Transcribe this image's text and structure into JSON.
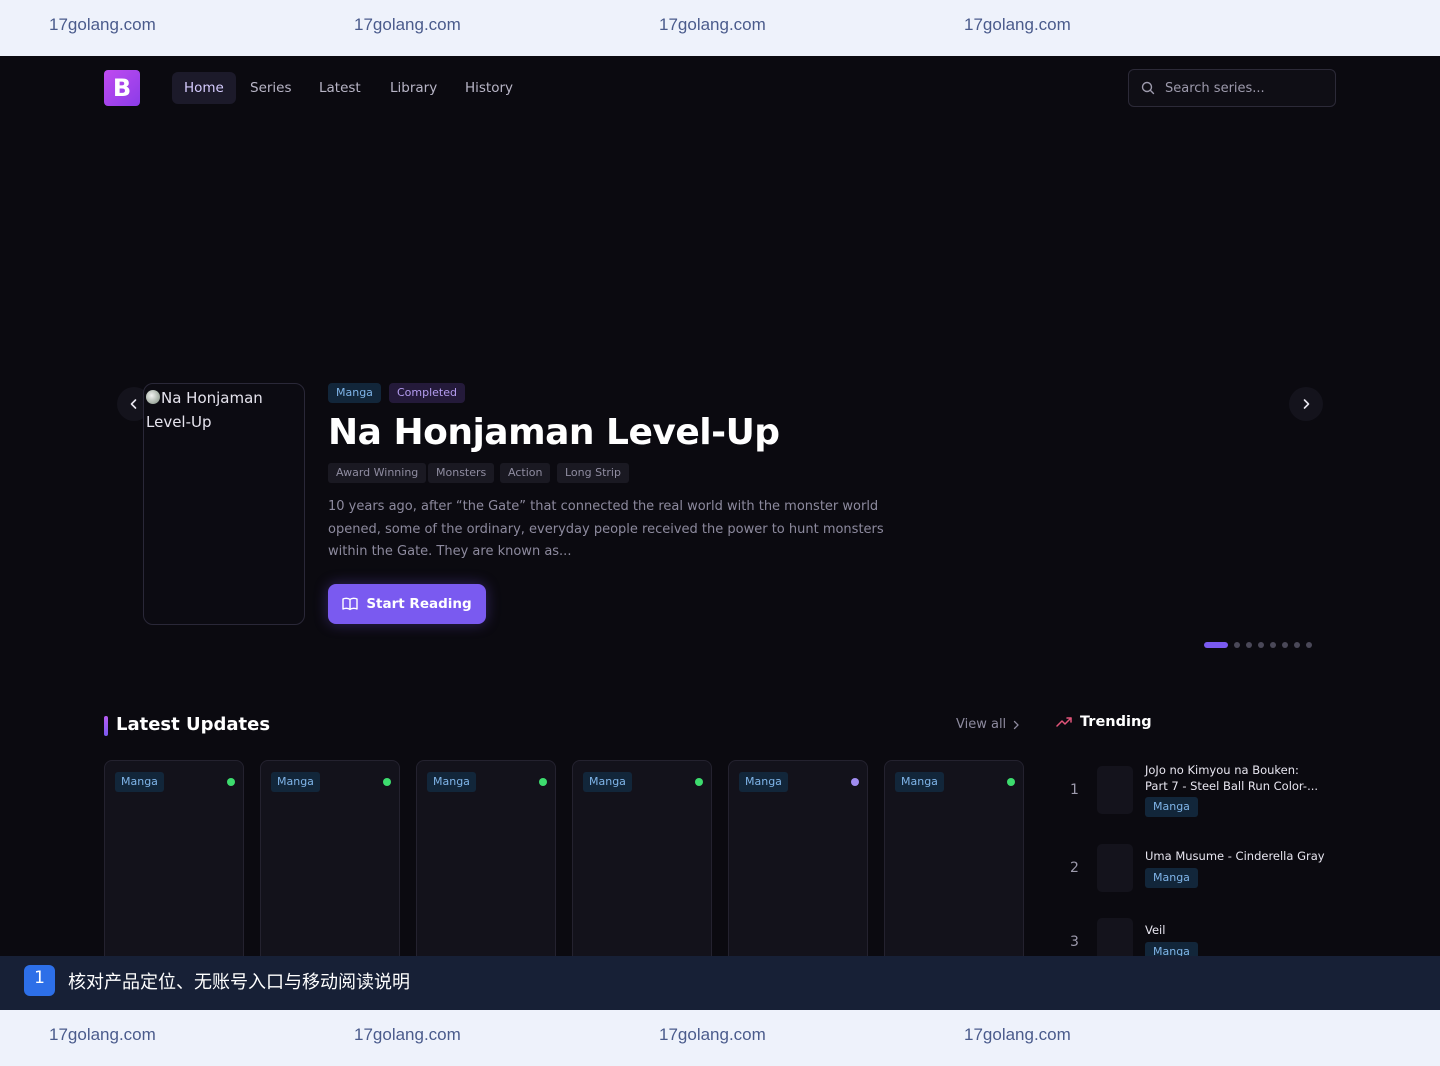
{
  "watermark": {
    "text": "17golang.com"
  },
  "nav": {
    "logo_letter": "B",
    "links": [
      "Home",
      "Series",
      "Latest",
      "Library",
      "History"
    ],
    "active": "Home",
    "search_placeholder": "Search series..."
  },
  "hero": {
    "cover_alt": "Na Honjaman Level-Up",
    "badges": {
      "type": "Manga",
      "status": "Completed"
    },
    "title": "Na Honjaman Level-Up",
    "tags": [
      "Award Winning",
      "Monsters",
      "Action",
      "Long Strip"
    ],
    "description": "10 years ago, after “the Gate” that connected the real world with the monster world opened, some of the ordinary, everyday people received the power to hunt monsters within the Gate. They are known as...",
    "cta_label": "Start Reading",
    "slide_count": 8,
    "active_slide": 1
  },
  "latest": {
    "title": "Latest Updates",
    "view_all": "View all",
    "cards": [
      {
        "badge": "Manga",
        "dot_color": "#3ddc6e"
      },
      {
        "badge": "Manga",
        "dot_color": "#3ddc6e"
      },
      {
        "badge": "Manga",
        "dot_color": "#3ddc6e"
      },
      {
        "badge": "Manga",
        "dot_color": "#3ddc6e"
      },
      {
        "badge": "Manga",
        "dot_color": "#a08cf0"
      },
      {
        "badge": "Manga",
        "dot_color": "#3ddc6e"
      }
    ]
  },
  "trending": {
    "title": "Trending",
    "items": [
      {
        "rank": "1",
        "title": "JoJo no Kimyou na Bouken: Part 7 - Steel Ball Run Color-...",
        "badge": "Manga"
      },
      {
        "rank": "2",
        "title": "Uma Musume - Cinderella Gray",
        "badge": "Manga"
      },
      {
        "rank": "3",
        "title": "Veil",
        "badge": "Manga"
      }
    ]
  },
  "notice": {
    "number": "1",
    "text": "核对产品定位、无账号入口与移动阅读说明"
  },
  "colors": {
    "accent": "#7a5af0",
    "background": "#0b0a10",
    "watermark_bg": "#eef2fb"
  }
}
